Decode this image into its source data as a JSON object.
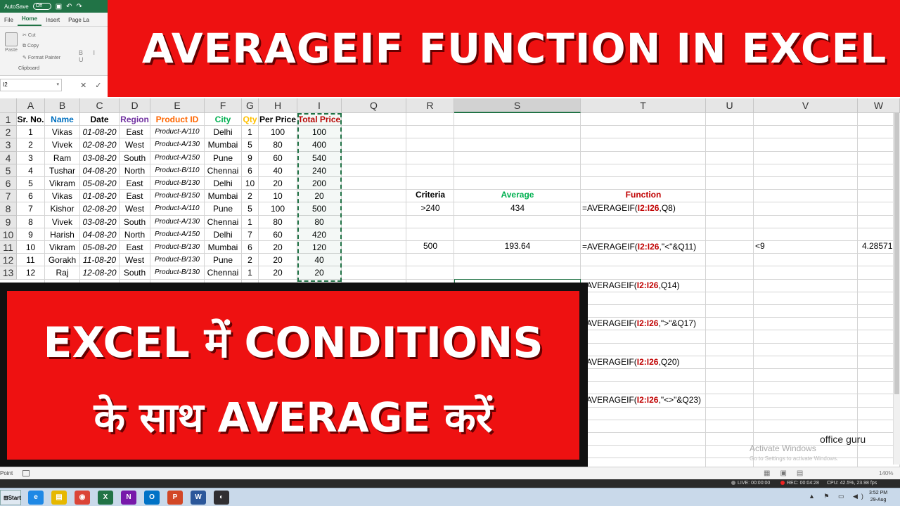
{
  "app": {
    "autosave_label": "AutoSave",
    "autosave_state": "Off",
    "ribbon_tabs": [
      "File",
      "Home",
      "Insert",
      "Page La"
    ],
    "active_tab": "Home",
    "clipboard": {
      "paste": "Paste",
      "cut": "Cut",
      "copy": "Copy",
      "format_painter": "Format Painter",
      "group_label": "Clipboard"
    },
    "font_buttons": "B I U",
    "name_box": "I2"
  },
  "sheet": {
    "columns": [
      "A",
      "B",
      "C",
      "D",
      "E",
      "F",
      "G",
      "H",
      "I",
      "Q",
      "R",
      "S",
      "T",
      "U",
      "V",
      "W"
    ],
    "selected_column": "S",
    "rows": [
      "1",
      "2",
      "3",
      "4",
      "5",
      "6",
      "7",
      "8",
      "9",
      "10",
      "11",
      "12",
      "13"
    ],
    "headers": [
      "Sr. No.",
      "Name",
      "Date",
      "Region",
      "Product ID",
      "City",
      "Qty",
      "Per Price",
      "Total Price"
    ],
    "header_colors": [
      "#000000",
      "#0070c0",
      "#000000",
      "#7030a0",
      "#ff6600",
      "#00b050",
      "#ffc000",
      "#000000",
      "#c00000"
    ],
    "data": [
      [
        "1",
        "Vikas",
        "01-08-20",
        "East",
        "Product-A/110",
        "Delhi",
        "1",
        "100",
        "100"
      ],
      [
        "2",
        "Vivek",
        "02-08-20",
        "West",
        "Product-A/130",
        "Mumbai",
        "5",
        "80",
        "400"
      ],
      [
        "3",
        "Ram",
        "03-08-20",
        "South",
        "Product-A/150",
        "Pune",
        "9",
        "60",
        "540"
      ],
      [
        "4",
        "Tushar",
        "04-08-20",
        "North",
        "Product-B/110",
        "Chennai",
        "6",
        "40",
        "240"
      ],
      [
        "5",
        "Vikram",
        "05-08-20",
        "East",
        "Product-B/130",
        "Delhi",
        "10",
        "20",
        "200"
      ],
      [
        "6",
        "Vikas",
        "01-08-20",
        "East",
        "Product-B/150",
        "Mumbai",
        "2",
        "10",
        "20"
      ],
      [
        "7",
        "Kishor",
        "02-08-20",
        "West",
        "Product-A/110",
        "Pune",
        "5",
        "100",
        "500"
      ],
      [
        "8",
        "Vivek",
        "03-08-20",
        "South",
        "Product-A/130",
        "Chennai",
        "1",
        "80",
        "80"
      ],
      [
        "9",
        "Harish",
        "04-08-20",
        "North",
        "Product-A/150",
        "Delhi",
        "7",
        "60",
        "420"
      ],
      [
        "10",
        "Vikram",
        "05-08-20",
        "East",
        "Product-B/130",
        "Mumbai",
        "6",
        "20",
        "120"
      ],
      [
        "11",
        "Gorakh",
        "11-08-20",
        "West",
        "Product-B/130",
        "Pune",
        "2",
        "20",
        "40"
      ],
      [
        "12",
        "Raj",
        "12-08-20",
        "South",
        "Product-B/130",
        "Chennai",
        "1",
        "20",
        "20"
      ]
    ],
    "criteria_header": "Criteria",
    "average_header": "Average",
    "function_header": "Function",
    "criteria_header_color": "#000000",
    "average_header_color": "#00b050",
    "function_header_color": "#c00000",
    "row8": {
      "criteria": ">240",
      "average": "434"
    },
    "row11": {
      "criteria": "500",
      "average": "193.64",
      "u": "<9",
      "w": "4.28571"
    },
    "functions": [
      {
        "prefix": "=AVERAGEIF(",
        "range": "I2:I26",
        "suffix": ",Q8)"
      },
      {
        "prefix": "=AVERAGEIF(",
        "range": "I2:I26",
        "suffix": ",\"<\"&Q11)"
      },
      {
        "prefix": "AVERAGEIF(",
        "range": "I2:I26",
        "suffix": ",Q14)"
      },
      {
        "prefix": "AVERAGEIF(",
        "range": "I2:I26",
        "suffix": ",\">\"&Q17)"
      },
      {
        "prefix": "AVERAGEIF(",
        "range": "I2:I26",
        "suffix": ",Q20)"
      },
      {
        "prefix": "AVERAGEIF(",
        "range": "I2:I26",
        "suffix": ",\"<>\"&Q23)"
      }
    ]
  },
  "banners": {
    "top": "AVERAGEIF FUNCTION IN EXCEL",
    "bottom_line1": "EXCEL में CONDITIONS",
    "bottom_line2": "के साथ AVERAGE करें",
    "color": "#ee1111"
  },
  "watermark": {
    "line1": "Activate Windows",
    "line2": "Go to Settings to activate Windows.",
    "brand": "office guru"
  },
  "status": {
    "ready": "Point",
    "zoom": "140%"
  },
  "recorder": {
    "live": "LIVE: 00:00:00",
    "rec": "REC: 00:04:28",
    "cpu": "CPU: 42.5%, 23.98 fps"
  },
  "taskbar": {
    "start": "Start",
    "apps": [
      {
        "name": "ie",
        "glyph": "e",
        "color": "#1e88e5"
      },
      {
        "name": "explorer",
        "glyph": "▤",
        "color": "#e6b800"
      },
      {
        "name": "chrome",
        "glyph": "◉",
        "color": "#db4437"
      },
      {
        "name": "excel",
        "glyph": "X",
        "color": "#217346"
      },
      {
        "name": "onenote",
        "glyph": "N",
        "color": "#7719aa"
      },
      {
        "name": "outlook",
        "glyph": "O",
        "color": "#0072c6"
      },
      {
        "name": "powerpoint",
        "glyph": "P",
        "color": "#d24726"
      },
      {
        "name": "word",
        "glyph": "W",
        "color": "#2b579a"
      },
      {
        "name": "obs",
        "glyph": "◐",
        "color": "#302e31"
      }
    ],
    "time": "3:52 PM",
    "date": "29-Aug"
  }
}
